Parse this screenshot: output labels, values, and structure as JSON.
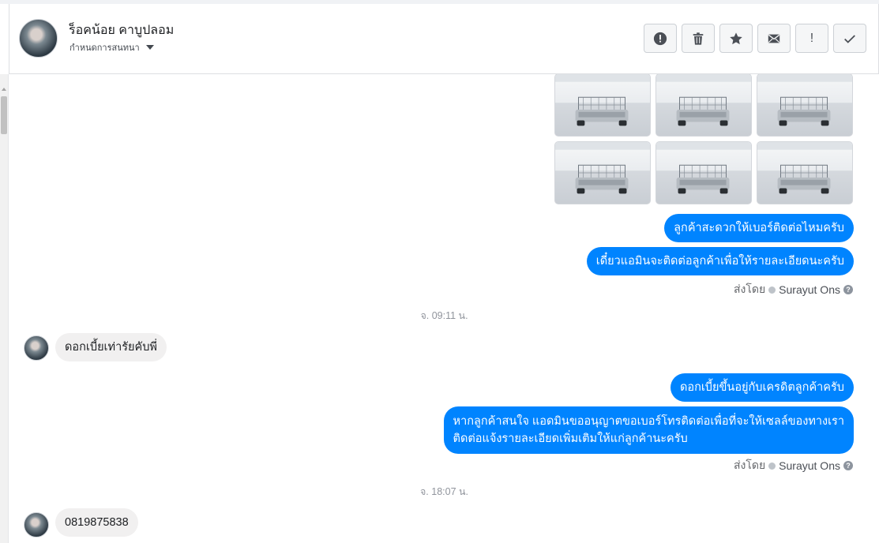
{
  "header": {
    "contact_name": "ร็อคน้อย คาบูปลอม",
    "assign_label": "กำหนดการสนทนา",
    "tools": [
      {
        "icon": "exclamation-circle-icon"
      },
      {
        "icon": "trash-icon"
      },
      {
        "icon": "star-icon"
      },
      {
        "icon": "envelope-icon"
      },
      {
        "icon": "exclamation-icon",
        "label": "!"
      },
      {
        "icon": "checkmark-icon"
      }
    ]
  },
  "thread": {
    "photos_count": 6,
    "messages": {
      "out1": "ลูกค้าสะดวกให้เบอร์ติดต่อไหมครับ",
      "out2": "เดี๋ยวแอมินจะติดต่อลูกค้าเพื่อให้รายละเอียดนะครับ",
      "sent_by_1": {
        "prefix": "ส่งโดย",
        "name": "Surayut Ons",
        "help": "?"
      },
      "time1": "จ. 09:11 น.",
      "in1": "ดอกเบี้ยเท่ารัยคับพี่",
      "out3": "ดอกเบี้ยขึ้นอยู่กับเครดิตลูกค้าครับ",
      "out4_line1": "หากลูกค้าสนใจ แอดมินขออนุญาตขอเบอร์โทรติดต่อเพื่อที่จะให้เซลล์ของทางเรา",
      "out4_line2": "ติดต่อแจ้งรายละเอียดเพิ่มเติมให้แก่ลูกค้านะครับ",
      "sent_by_2": {
        "prefix": "ส่งโดย",
        "name": "Surayut Ons",
        "help": "?"
      },
      "time2": "จ. 18:07 น.",
      "in2": "0819875838"
    }
  },
  "colors": {
    "outgoing_bubble": "#0084ff",
    "incoming_bubble": "#f1f0f0",
    "timestamp": "#90949c"
  }
}
